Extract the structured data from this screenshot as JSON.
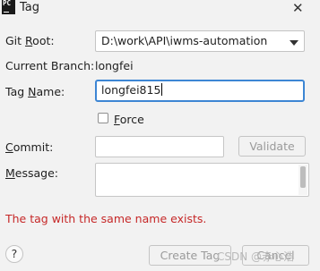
{
  "window": {
    "app_icon_text": "PC",
    "title": "Tag",
    "close_glyph": "✕",
    "close_icon": "close-icon"
  },
  "form": {
    "git_root_label": "Git Root:",
    "git_root_value": "D:\\work\\API\\iwms-automation",
    "current_branch_label": "Current Branch:",
    "current_branch_value": "longfei",
    "tag_name_label": "Tag Name:",
    "tag_name_value": "longfei815",
    "force_label": "Force",
    "force_checked": false,
    "commit_label": "Commit:",
    "commit_value": "",
    "validate_label": "Validate",
    "message_label": "Message:",
    "message_value": ""
  },
  "error_text": "The tag with the same name exists.",
  "footer": {
    "help_glyph": "?",
    "create_tag_label": "Create Tag",
    "cancel_label": "Cancel",
    "watermark": "CSDN @赤心浩"
  },
  "colors": {
    "error": "#c62828",
    "focus_border": "#3d86d4",
    "disabled_text": "#9a9a9a"
  }
}
